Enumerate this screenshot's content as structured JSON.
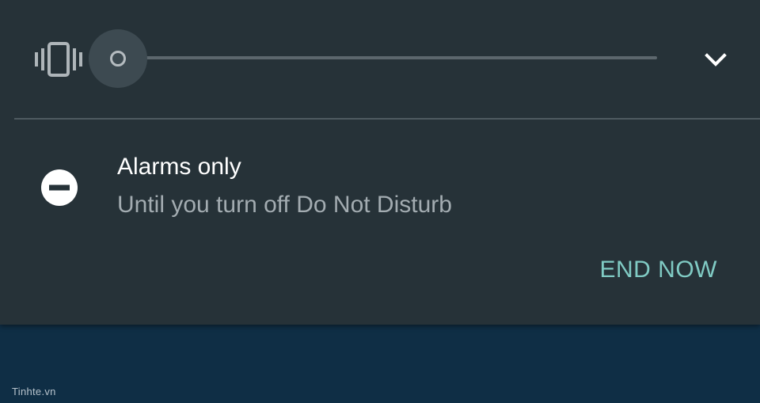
{
  "volume": {
    "icon": "vibrate-icon",
    "level": 0,
    "expand_icon": "chevron-down-icon"
  },
  "dnd": {
    "icon": "do-not-disturb-icon",
    "title": "Alarms only",
    "subtitle": "Until you turn off Do Not Disturb",
    "end_now_label": "END NOW"
  },
  "watermark": "Tinhte.vn",
  "colors": {
    "panel": "#263238",
    "background": "#0f2e45",
    "accent": "#80cbc4",
    "primary_text": "#ffffff",
    "secondary_text": "#a3acb1"
  }
}
